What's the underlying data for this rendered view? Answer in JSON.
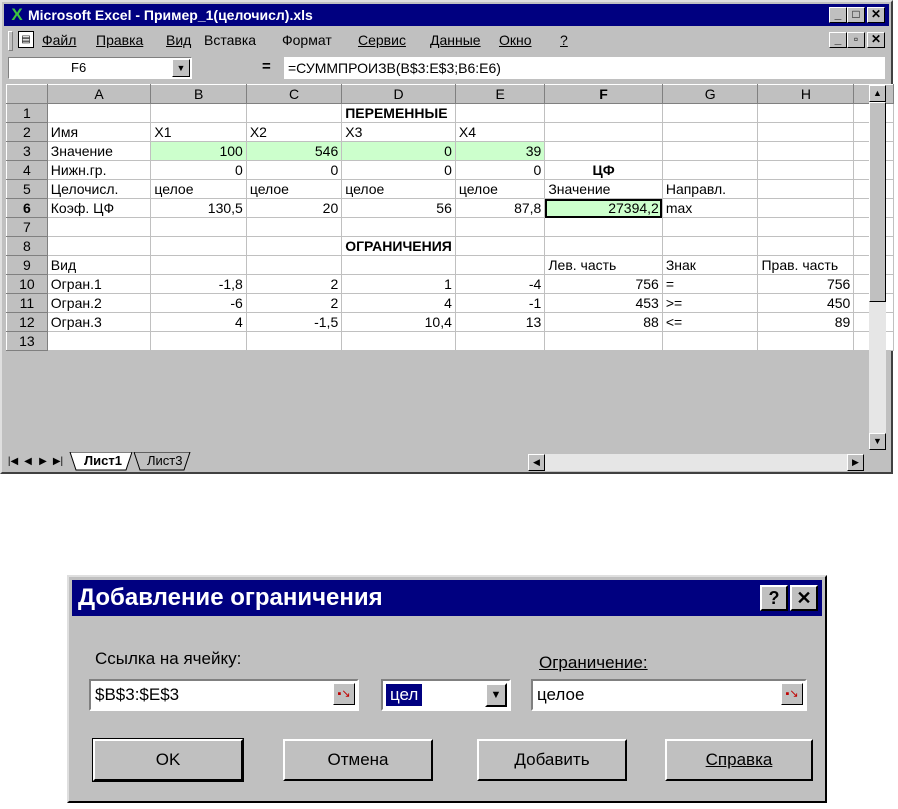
{
  "window": {
    "title": "Microsoft Excel - Пример_1(целочисл).xls",
    "minimize": "_",
    "restore": "□",
    "close": "✕",
    "doc_minimize": "_",
    "doc_restore": "▫",
    "doc_close": "✕"
  },
  "menu": [
    "Файл",
    "Правка",
    "Вид",
    "Вставка",
    "Формат",
    "Сервис",
    "Данные",
    "Окно",
    "?"
  ],
  "formula_bar": {
    "name_box": "F6",
    "equals": "=",
    "formula": "=СУММПРОИЗВ(B$3:E$3;B6:E6)"
  },
  "columns": [
    "A",
    "B",
    "C",
    "D",
    "E",
    "F",
    "G",
    "H"
  ],
  "rows": [
    {
      "num": "1",
      "cells": [
        "",
        "",
        "",
        "ПЕРЕМЕННЫЕ",
        "",
        "",
        "",
        ""
      ]
    },
    {
      "num": "2",
      "cells": [
        "Имя",
        "X1",
        "X2",
        "X3",
        "X4",
        "",
        "",
        ""
      ]
    },
    {
      "num": "3",
      "cells": [
        "Значение",
        "100",
        "546",
        "0",
        "39",
        "",
        "",
        ""
      ]
    },
    {
      "num": "4",
      "cells": [
        "Нижн.гр.",
        "0",
        "0",
        "0",
        "0",
        "ЦФ",
        "",
        ""
      ]
    },
    {
      "num": "5",
      "cells": [
        "Целочисл.",
        "целое",
        "целое",
        "целое",
        "целое",
        "Значение",
        "Направл.",
        ""
      ]
    },
    {
      "num": "6",
      "cells": [
        "Коэф. ЦФ",
        "130,5",
        "20",
        "56",
        "87,8",
        "27394,2",
        "max",
        ""
      ]
    },
    {
      "num": "7",
      "cells": [
        "",
        "",
        "",
        "",
        "",
        "",
        "",
        ""
      ]
    },
    {
      "num": "8",
      "cells": [
        "",
        "",
        "",
        "ОГРАНИЧЕНИЯ",
        "",
        "",
        "",
        ""
      ]
    },
    {
      "num": "9",
      "cells": [
        "Вид",
        "",
        "",
        "",
        "",
        "Лев. часть",
        "Знак",
        "Прав. часть"
      ]
    },
    {
      "num": "10",
      "cells": [
        "Огран.1",
        "-1,8",
        "2",
        "1",
        "-4",
        "756",
        "=",
        "756"
      ]
    },
    {
      "num": "11",
      "cells": [
        "Огран.2",
        "-6",
        "2",
        "4",
        "-1",
        "453",
        ">=",
        "450"
      ]
    },
    {
      "num": "12",
      "cells": [
        "Огран.3",
        "4",
        "-1,5",
        "10,4",
        "13",
        "88",
        "<=",
        "89"
      ]
    },
    {
      "num": "13",
      "cells": [
        "",
        "",
        "",
        "",
        "",
        "",
        "",
        ""
      ]
    }
  ],
  "sheet_tabs": [
    "Лист1",
    "Лист3"
  ],
  "dialog": {
    "title": "Добавление ограничения",
    "help_btn": "?",
    "close_btn": "✕",
    "cell_ref_label": "Ссылка на ячейку:",
    "cell_ref_value": "$B$3:$E$3",
    "operator_value": "цел",
    "constraint_label": "Ограничение:",
    "constraint_value": "целое",
    "ok": "OK",
    "cancel": "Отмена",
    "add": "Добавить",
    "help": "Справка"
  }
}
